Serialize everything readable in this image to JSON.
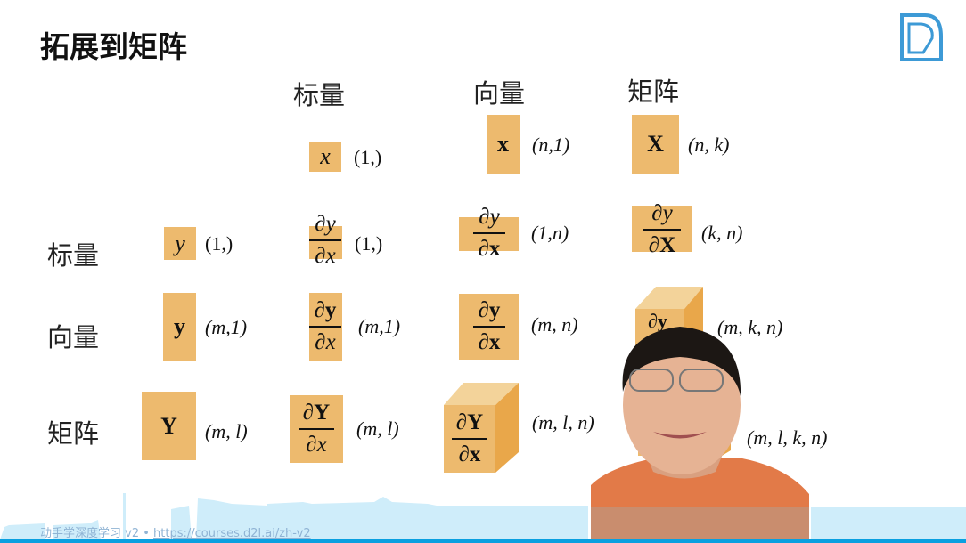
{
  "title": "拓展到矩阵",
  "logo": {
    "alt": "d2l"
  },
  "columns": [
    "标量",
    "向量",
    "矩阵"
  ],
  "rows": [
    "标量",
    "向量",
    "矩阵"
  ],
  "top_row": [
    {
      "symbol": "x",
      "shape": "(1,)"
    },
    {
      "symbol": "x",
      "shape": "(n,1)"
    },
    {
      "symbol": "X",
      "shape": "(n, k)"
    }
  ],
  "grid": {
    "scalar": [
      {
        "symbol": "y",
        "shape": "(1,)"
      },
      {
        "num": "∂y",
        "den": "∂x",
        "shape": "(1,)"
      },
      {
        "num": "∂y",
        "den": "∂x",
        "shape": "(1,n)"
      },
      {
        "num": "∂y",
        "den": "∂X",
        "shape": "(k, n)"
      }
    ],
    "vector": [
      {
        "symbol": "y",
        "shape": "(m,1)"
      },
      {
        "num": "∂y",
        "den": "∂x",
        "shape": "(m,1)"
      },
      {
        "num": "∂y",
        "den": "∂x",
        "shape": "(m, n)"
      },
      {
        "num": "∂y",
        "shape": "(m, k, n)"
      }
    ],
    "matrix": [
      {
        "symbol": "Y",
        "shape": "(m, l)"
      },
      {
        "num": "∂Y",
        "den": "∂x",
        "shape": "(m, l)"
      },
      {
        "num": "∂Y",
        "den": "∂x",
        "shape": "(m, l, n)"
      },
      {
        "shape": "(m, l, k, n)"
      }
    ]
  },
  "footer": {
    "course": "动手学深度学习 v2 • ",
    "url": "https://courses.d2l.ai/zh-v2"
  },
  "colors": {
    "box": "#EDBA6E",
    "accent": "#0AA0E0"
  }
}
